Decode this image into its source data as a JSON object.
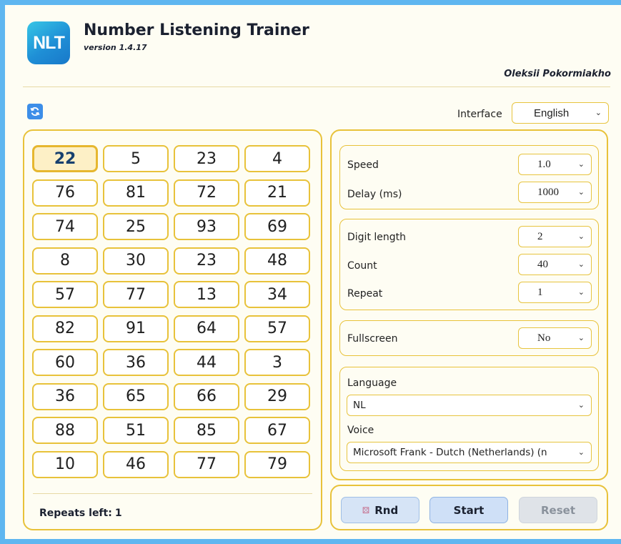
{
  "header": {
    "logo_text": "NLT",
    "title": "Number Listening Trainer",
    "version": "version 1.4.17",
    "author": "Oleksii Pokormiakho"
  },
  "interface": {
    "label": "Interface",
    "value": "English"
  },
  "grid": {
    "numbers": [
      22,
      5,
      23,
      4,
      76,
      81,
      72,
      21,
      74,
      25,
      93,
      69,
      8,
      30,
      23,
      48,
      57,
      77,
      13,
      34,
      82,
      91,
      64,
      57,
      60,
      36,
      44,
      3,
      36,
      65,
      66,
      29,
      88,
      51,
      85,
      67,
      10,
      46,
      77,
      79
    ],
    "active_index": 0,
    "repeats_left_label": "Repeats left:",
    "repeats_left_value": "1"
  },
  "settings": {
    "speed": {
      "label": "Speed",
      "value": "1.0"
    },
    "delay": {
      "label": "Delay (ms)",
      "value": "1000"
    },
    "digit_length": {
      "label": "Digit length",
      "value": "2"
    },
    "count": {
      "label": "Count",
      "value": "40"
    },
    "repeat": {
      "label": "Repeat",
      "value": "1"
    },
    "fullscreen": {
      "label": "Fullscreen",
      "value": "No"
    },
    "language": {
      "label": "Language",
      "value": "NL"
    },
    "voice": {
      "label": "Voice",
      "value": "Microsoft Frank - Dutch (Netherlands) (n"
    }
  },
  "buttons": {
    "rnd": "Rnd",
    "start": "Start",
    "reset": "Reset"
  },
  "colors": {
    "accent_border": "#e8c23a",
    "background": "#fefdf3",
    "outer_frame": "#5fb6f0",
    "active_cell": "#fdf0c6",
    "logo_blue": "#1f8fd6"
  },
  "icons": {
    "refresh": "refresh-icon",
    "dice": "dice-icon",
    "chevron": "chevron-down-icon"
  }
}
